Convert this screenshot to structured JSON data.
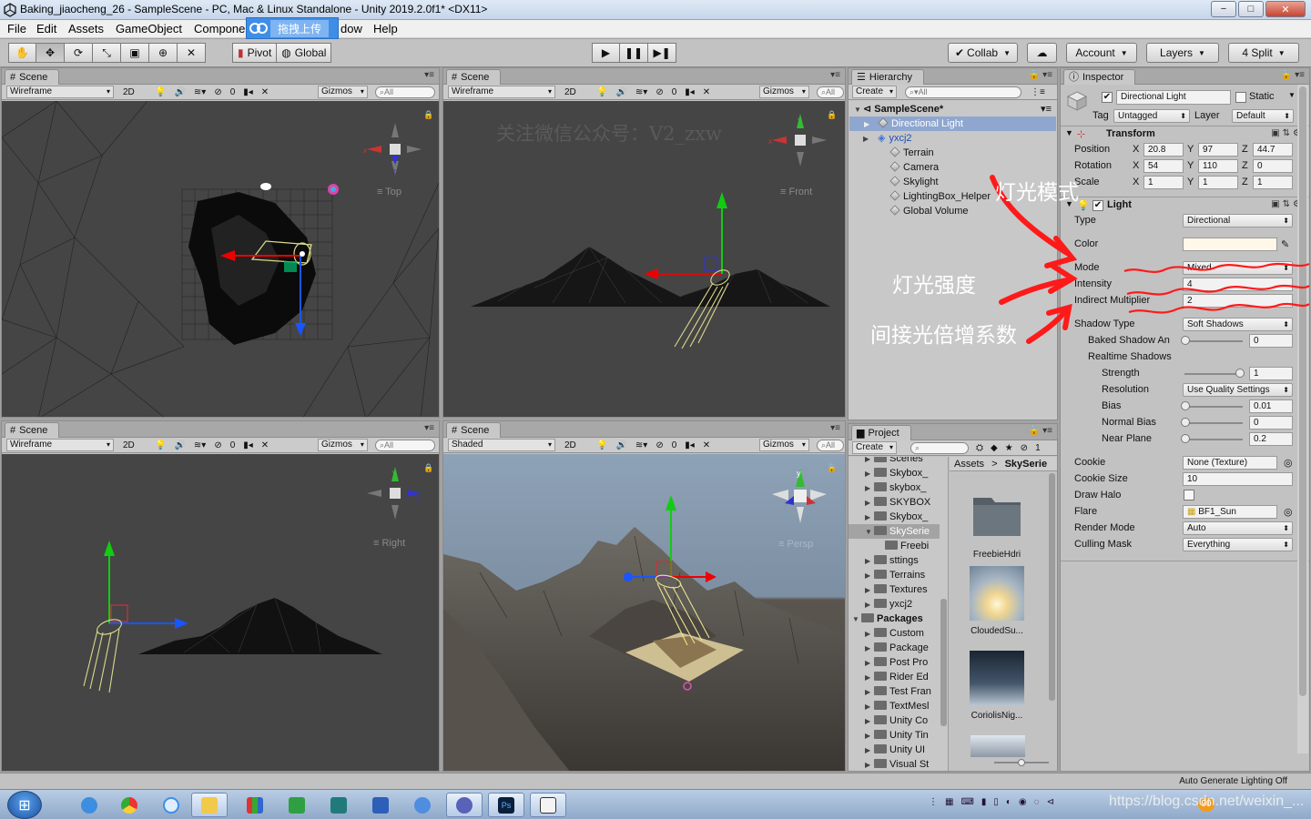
{
  "window": {
    "title": "Baking_jiaocheng_26 - SampleScene - PC, Mac & Linux Standalone - Unity 2019.2.0f1* <DX11>",
    "min": "−",
    "max": "□",
    "close": "✕"
  },
  "menu": {
    "file": "File",
    "edit": "Edit",
    "assets": "Assets",
    "gameobject": "GameObject",
    "component": "Compone",
    "window": "dow",
    "help": "Help"
  },
  "upload_overlay": {
    "label": "拖拽上传"
  },
  "toolbar": {
    "pivot": "Pivot",
    "global": "Global",
    "collab": "Collab",
    "account": "Account",
    "layers": "Layers",
    "layout": "4 Split"
  },
  "scene_views": [
    {
      "tab": "Scene",
      "draw_mode": "Wireframe",
      "btn_2d": "2D",
      "fx_count": "0",
      "gizmos": "Gizmos",
      "search": "All",
      "axis_label": "Top"
    },
    {
      "tab": "Scene",
      "draw_mode": "Wireframe",
      "btn_2d": "2D",
      "fx_count": "0",
      "gizmos": "Gizmos",
      "search": "All",
      "axis_label": "Front",
      "watermark": "关注微信公众号：V2_zxw"
    },
    {
      "tab": "Scene",
      "draw_mode": "Wireframe",
      "btn_2d": "2D",
      "fx_count": "0",
      "gizmos": "Gizmos",
      "search": "All",
      "axis_label": "Right"
    },
    {
      "tab": "Scene",
      "draw_mode": "Shaded",
      "btn_2d": "2D",
      "fx_count": "0",
      "gizmos": "Gizmos",
      "search": "All",
      "axis_label": "Persp"
    }
  ],
  "hierarchy": {
    "tab": "Hierarchy",
    "create": "Create",
    "search": "All",
    "scene": "SampleScene*",
    "items": [
      "Directional Light",
      "yxcj2",
      "Terrain",
      "Camera",
      "Skylight",
      "LightingBox_Helper",
      "Global Volume"
    ]
  },
  "annotations": {
    "light_mode": "灯光模式",
    "intensity": "灯光强度",
    "indirect": "间接光倍增系数"
  },
  "project": {
    "tab": "Project",
    "create": "Create",
    "breadcrumb_root": "Assets",
    "breadcrumb_sep": ">",
    "breadcrumb_current": "SkySerie",
    "hidden_count": "1",
    "tree": [
      {
        "label": "Scenes",
        "indent": 1
      },
      {
        "label": "Skybox_",
        "indent": 1
      },
      {
        "label": "skybox_",
        "indent": 1
      },
      {
        "label": "SKYBOX",
        "indent": 1
      },
      {
        "label": "Skybox_",
        "indent": 1
      },
      {
        "label": "SkySerie",
        "indent": 1,
        "selected": true
      },
      {
        "label": "Freebi",
        "indent": 2
      },
      {
        "label": "sttings",
        "indent": 1
      },
      {
        "label": "Terrains",
        "indent": 1
      },
      {
        "label": "Textures",
        "indent": 1
      },
      {
        "label": "yxcj2",
        "indent": 1
      },
      {
        "label": "Packages",
        "indent": 0,
        "bold": true
      },
      {
        "label": "Custom",
        "indent": 1
      },
      {
        "label": "Package",
        "indent": 1
      },
      {
        "label": "Post Pro",
        "indent": 1
      },
      {
        "label": "Rider Ed",
        "indent": 1
      },
      {
        "label": "Test Fran",
        "indent": 1
      },
      {
        "label": "TextMesl",
        "indent": 1
      },
      {
        "label": "Unity Co",
        "indent": 1
      },
      {
        "label": "Unity Tin",
        "indent": 1
      },
      {
        "label": "Unity UI",
        "indent": 1
      },
      {
        "label": "Visual St",
        "indent": 1
      }
    ],
    "assets": [
      "FreebieHdri",
      "CloudedSu...",
      "CoriolisNig..."
    ]
  },
  "inspector": {
    "tab": "Inspector",
    "object_name": "Directional Light",
    "static": "Static",
    "tag_label": "Tag",
    "tag_value": "Untagged",
    "layer_label": "Layer",
    "layer_value": "Default",
    "transform": {
      "title": "Transform",
      "position_label": "Position",
      "position": {
        "x": "20.8",
        "y": "97",
        "z": "44.7"
      },
      "rotation_label": "Rotation",
      "rotation": {
        "x": "54",
        "y": "110",
        "z": "0"
      },
      "scale_label": "Scale",
      "scale": {
        "x": "1",
        "y": "1",
        "z": "1"
      },
      "x": "X",
      "y": "Y",
      "z": "Z"
    },
    "light": {
      "title": "Light",
      "type_label": "Type",
      "type_value": "Directional",
      "color_label": "Color",
      "mode_label": "Mode",
      "mode_value": "Mixed",
      "intensity_label": "Intensity",
      "intensity_value": "4",
      "indirect_label": "Indirect Multiplier",
      "indirect_value": "2",
      "shadow_type_label": "Shadow Type",
      "shadow_type_value": "Soft Shadows",
      "baked_angle_label": "Baked Shadow An",
      "baked_angle_value": "0",
      "realtime_label": "Realtime Shadows",
      "strength_label": "Strength",
      "strength_value": "1",
      "resolution_label": "Resolution",
      "resolution_value": "Use Quality Settings",
      "bias_label": "Bias",
      "bias_value": "0.01",
      "normal_bias_label": "Normal Bias",
      "normal_bias_value": "0",
      "near_plane_label": "Near Plane",
      "near_plane_value": "0.2",
      "cookie_label": "Cookie",
      "cookie_value": "None (Texture)",
      "cookie_size_label": "Cookie Size",
      "cookie_size_value": "10",
      "draw_halo_label": "Draw Halo",
      "flare_label": "Flare",
      "flare_value": "BF1_Sun",
      "render_mode_label": "Render Mode",
      "render_mode_value": "Auto",
      "culling_label": "Culling Mask",
      "culling_value": "Everything"
    },
    "sliders": {
      "baked_angle": 0.0,
      "strength": 1.0,
      "bias": 0.0,
      "normal_bias": 0.0,
      "near_plane": 0.0
    }
  },
  "status": {
    "right": "Auto Generate Lighting Off"
  },
  "taskbar": {
    "watermark": "https://blog.csdn.net/weixin_...",
    "badge": "90"
  },
  "colors": {
    "unity_panel": "#c2c2c2",
    "selection": "#8fa7cf",
    "annotation_red": "#ff1a1a",
    "light_color": "#fff8e8"
  }
}
